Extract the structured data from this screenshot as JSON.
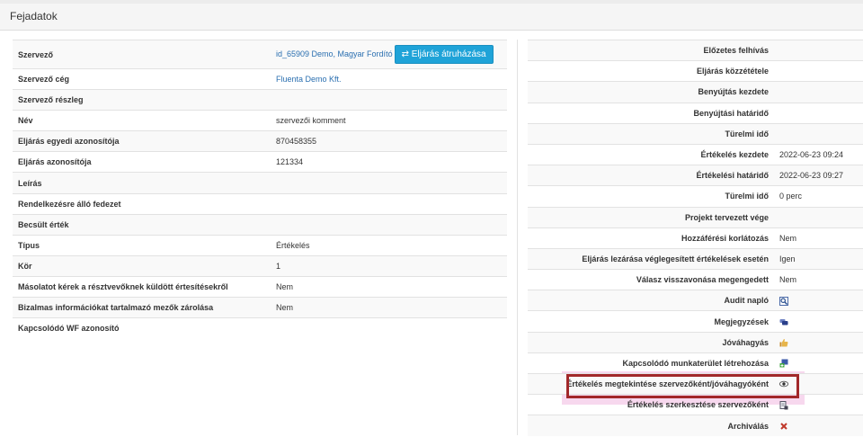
{
  "panel": {
    "title": "Fejadatok"
  },
  "left_rows": [
    {
      "label": "Szervező",
      "value": "id_65909 Demo, Magyar Fordító",
      "button": "Eljárás átruházása"
    },
    {
      "label": "Szervező cég",
      "value": "Fluenta Demo Kft."
    },
    {
      "label": "Szervező részleg",
      "value": ""
    },
    {
      "label": "Név",
      "value": "szervezői komment"
    },
    {
      "label": "Eljárás egyedi azonosítója",
      "value": "870458355"
    },
    {
      "label": "Eljárás azonosítója",
      "value": "121334"
    },
    {
      "label": "Leírás",
      "value": ""
    },
    {
      "label": "Rendelkezésre álló fedezet",
      "value": ""
    },
    {
      "label": "Becsült érték",
      "value": ""
    },
    {
      "label": "Típus",
      "value": "Értékelés"
    },
    {
      "label": "Kör",
      "value": "1"
    },
    {
      "label": "Másolatot kérek a résztvevőknek küldött értesítésekről",
      "value": "Nem"
    },
    {
      "label": "Bizalmas információkat tartalmazó mezők zárolása",
      "value": "Nem"
    },
    {
      "label": "Kapcsolódó WF azonosító",
      "value": ""
    }
  ],
  "right_rows": [
    {
      "label": "Előzetes felhívás",
      "value": ""
    },
    {
      "label": "Eljárás közzététele",
      "value": ""
    },
    {
      "label": "Benyújtás kezdete",
      "value": ""
    },
    {
      "label": "Benyújtási határidő",
      "value": ""
    },
    {
      "label": "Türelmi idő",
      "value": ""
    },
    {
      "label": "Értékelés kezdete",
      "value": "2022-06-23 09:24"
    },
    {
      "label": "Értékelési határidő",
      "value": "2022-06-23 09:27"
    },
    {
      "label": "Türelmi idő",
      "value": "0 perc"
    },
    {
      "label": "Projekt tervezett vége",
      "value": ""
    },
    {
      "label": "Hozzáférési korlátozás",
      "value": "Nem"
    },
    {
      "label": "Eljárás lezárása véglegesített értékelések esetén",
      "value": "Igen"
    },
    {
      "label": "Válasz visszavonása megengedett",
      "value": "Nem"
    },
    {
      "label": "Audit napló",
      "icon": "magnifier-icon"
    },
    {
      "label": "Megjegyzések",
      "icon": "comments-icon"
    },
    {
      "label": "Jóváhagyás",
      "icon": "thumbs-up-icon"
    },
    {
      "label": "Kapcsolódó munkaterület létrehozása",
      "icon": "workspace-add-icon"
    },
    {
      "label": "Értékelés megtekintése szervezőként/jóváhagyóként",
      "icon": "eye-icon"
    },
    {
      "label": "Értékelés szerkesztése szervezőként",
      "icon": "edit-doc-icon"
    },
    {
      "label": "Archiválás",
      "icon": "close-x-icon"
    }
  ],
  "colors": {
    "accent": "#1fa3d8",
    "link": "#2a6fb0",
    "highlight_border": "#a2282a",
    "highlight_glow": "#f7d8ee"
  }
}
